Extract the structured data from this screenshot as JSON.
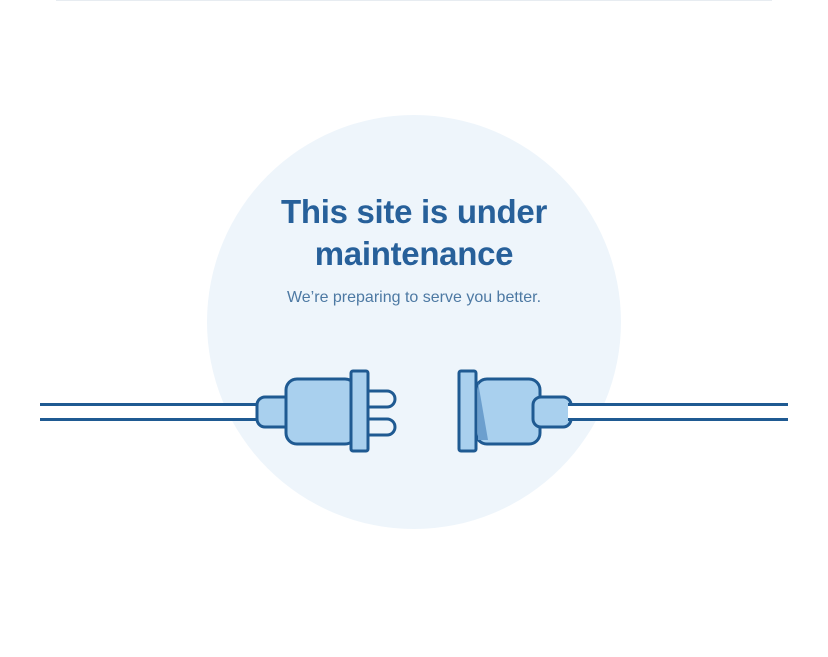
{
  "maintenance": {
    "title_line1": "This site is under",
    "title_line2": "maintenance",
    "subtitle": "We’re preparing to serve you better."
  },
  "illustration": {
    "icon": "unplugged-cable-icon",
    "colors": {
      "background_circle": "#eef5fb",
      "outline": "#1f5a92",
      "fill": "#a9d0ee",
      "shade": "#6c9fce",
      "title": "#27609a",
      "subtitle": "#4d79a3"
    }
  }
}
